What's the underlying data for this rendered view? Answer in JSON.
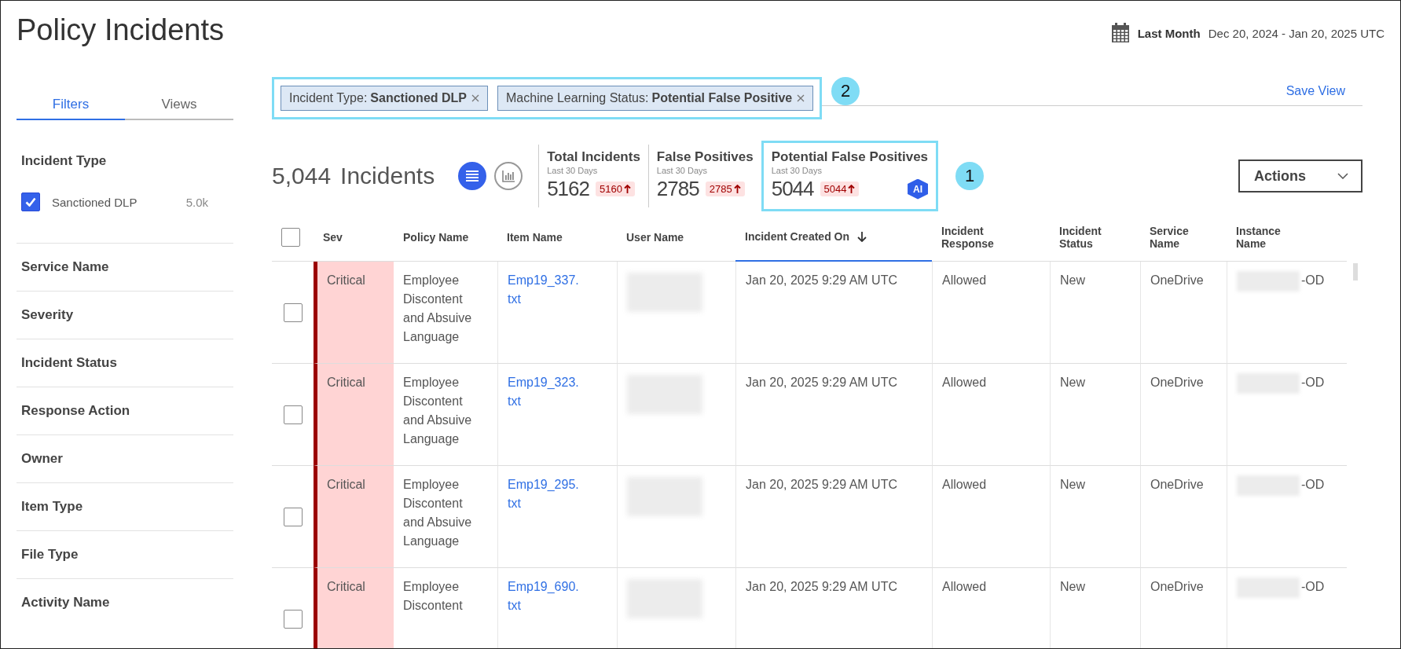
{
  "page": {
    "title": "Policy Incidents"
  },
  "date_range": {
    "preset": "Last Month",
    "range": "Dec 20, 2024 - Jan 20, 2025 UTC"
  },
  "sidebar": {
    "tabs": [
      {
        "label": "Filters",
        "selected": true
      },
      {
        "label": "Views",
        "selected": false
      }
    ],
    "filter_groups": [
      {
        "title": "Incident Type",
        "options": [
          {
            "label": "Sanctioned DLP",
            "count": "5.0k",
            "checked": true
          }
        ]
      },
      {
        "title": "Service Name"
      },
      {
        "title": "Severity"
      },
      {
        "title": "Incident Status"
      },
      {
        "title": "Response Action"
      },
      {
        "title": "Owner"
      },
      {
        "title": "Item Type"
      },
      {
        "title": "File Type"
      },
      {
        "title": "Activity Name"
      }
    ]
  },
  "filter_bar": {
    "chips": [
      {
        "name": "Incident Type:",
        "value": "Sanctioned DLP"
      },
      {
        "name": "Machine Learning Status:",
        "value": "Potential False Positive"
      }
    ],
    "callout": "2",
    "save_view": "Save View"
  },
  "summary": {
    "count": "5,044",
    "label": "Incidents",
    "view_modes": [
      {
        "kind": "list",
        "selected": true
      },
      {
        "kind": "chart",
        "selected": false
      }
    ]
  },
  "stats": [
    {
      "title": "Total Incidents",
      "period": "Last 30 Days",
      "value": "5162",
      "change": "5160",
      "highlighted": false
    },
    {
      "title": "False Positives",
      "period": "Last 30 Days",
      "value": "2785",
      "change": "2785",
      "highlighted": false
    },
    {
      "title": "Potential False Positives",
      "period": "Last 30 Days",
      "value": "5044",
      "change": "5044",
      "highlighted": true,
      "badge": "AI",
      "callout": "1"
    }
  ],
  "actions": {
    "label": "Actions"
  },
  "table": {
    "select_all_checked": false,
    "columns": [
      {
        "label": "Sev",
        "sorted": false
      },
      {
        "label": "Policy Name",
        "sorted": false
      },
      {
        "label": "Item Name",
        "sorted": false
      },
      {
        "label": "User Name",
        "sorted": false
      },
      {
        "label": "Incident Created On",
        "sorted": true
      },
      {
        "label": "Incident Response",
        "sorted": false
      },
      {
        "label": "Incident Status",
        "sorted": false
      },
      {
        "label": "Service Name",
        "sorted": false
      },
      {
        "label": "Instance Name",
        "sorted": false
      }
    ],
    "rows": [
      {
        "checked": false,
        "severity": "Critical",
        "policy": "Employee Discontent and Absuive Language",
        "item": "Emp19_337.txt",
        "created": "Jan 20, 2025 9:29 AM UTC",
        "response": "Allowed",
        "status": "New",
        "service": "OneDrive",
        "instance": "-OD"
      },
      {
        "checked": false,
        "severity": "Critical",
        "policy": "Employee Discontent and Absuive Language",
        "item": "Emp19_323.txt",
        "created": "Jan 20, 2025 9:29 AM UTC",
        "response": "Allowed",
        "status": "New",
        "service": "OneDrive",
        "instance": "-OD"
      },
      {
        "checked": false,
        "severity": "Critical",
        "policy": "Employee Discontent and Absuive Language",
        "item": "Emp19_295.txt",
        "created": "Jan 20, 2025 9:29 AM UTC",
        "response": "Allowed",
        "status": "New",
        "service": "OneDrive",
        "instance": "-OD"
      },
      {
        "checked": false,
        "severity": "Critical",
        "policy": "Employee Discontent",
        "item": "Emp19_690.txt",
        "created": "Jan 20, 2025 9:29 AM UTC",
        "response": "Allowed",
        "status": "New",
        "service": "OneDrive",
        "instance": "-OD"
      }
    ]
  }
}
